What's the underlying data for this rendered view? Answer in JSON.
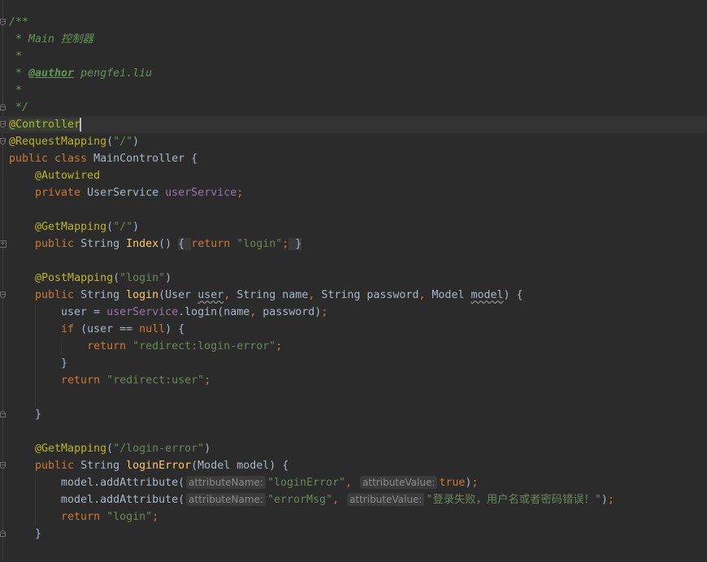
{
  "theme_colors": {
    "background": "#2B2B2B",
    "caret_row": "#323232",
    "keyword": "#CC7832",
    "string": "#6A8759",
    "annotation": "#BBB529",
    "doc_comment": "#629755",
    "field": "#9876AA",
    "method": "#FFC66D",
    "default": "#A9B7C6"
  },
  "caret_line": 6,
  "lines": [
    [
      {
        "t": "/**",
        "c": "doc"
      }
    ],
    [
      {
        "t": " * Main 控制器",
        "c": "doc"
      }
    ],
    [
      {
        "t": " *",
        "c": "doc"
      }
    ],
    [
      {
        "t": " * ",
        "c": "doc"
      },
      {
        "t": "@author",
        "c": "tag"
      },
      {
        "t": " pengfei.liu",
        "c": "doc"
      }
    ],
    [
      {
        "t": " *",
        "c": "doc"
      }
    ],
    [
      {
        "t": " */",
        "c": "doc"
      }
    ],
    [
      {
        "t": "@Controller",
        "c": "ann hl"
      }
    ],
    [
      {
        "t": "@RequestMapping",
        "c": "ann"
      },
      {
        "t": "(",
        "c": "def"
      },
      {
        "t": "\"/\"",
        "c": "str"
      },
      {
        "t": ")",
        "c": "def"
      }
    ],
    [
      {
        "t": "public class ",
        "c": "kw"
      },
      {
        "t": "MainController {",
        "c": "def"
      }
    ],
    [
      {
        "t": "    ",
        "c": "def"
      },
      {
        "t": "@Autowired",
        "c": "ann"
      }
    ],
    [
      {
        "t": "    private ",
        "c": "kw"
      },
      {
        "t": "UserService ",
        "c": "def"
      },
      {
        "t": "userService",
        "c": "fld"
      },
      {
        "t": ";",
        "c": "kw"
      }
    ],
    [],
    [
      {
        "t": "    ",
        "c": "def"
      },
      {
        "t": "@GetMapping",
        "c": "ann"
      },
      {
        "t": "(",
        "c": "def"
      },
      {
        "t": "\"/\"",
        "c": "str"
      },
      {
        "t": ")",
        "c": "def"
      }
    ],
    [
      {
        "t": "    public ",
        "c": "kw"
      },
      {
        "t": "String ",
        "c": "def"
      },
      {
        "t": "Index",
        "c": "mth"
      },
      {
        "t": "() ",
        "c": "def"
      },
      {
        "t": "{ ",
        "c": "folded"
      },
      {
        "t": "return ",
        "c": "kw"
      },
      {
        "t": "\"login\"",
        "c": "str"
      },
      {
        "t": ";",
        "c": "kw"
      },
      {
        "t": " }",
        "c": "folded"
      }
    ],
    [],
    [
      {
        "t": "    ",
        "c": "def"
      },
      {
        "t": "@PostMapping",
        "c": "ann"
      },
      {
        "t": "(",
        "c": "def"
      },
      {
        "t": "\"login\"",
        "c": "str"
      },
      {
        "t": ")",
        "c": "def"
      }
    ],
    [
      {
        "t": "    public ",
        "c": "kw"
      },
      {
        "t": "String ",
        "c": "def"
      },
      {
        "t": "login",
        "c": "mth"
      },
      {
        "t": "(User ",
        "c": "def"
      },
      {
        "t": "user",
        "c": "warn"
      },
      {
        "t": ", ",
        "c": "kw"
      },
      {
        "t": "String name",
        "c": "def"
      },
      {
        "t": ", ",
        "c": "kw"
      },
      {
        "t": "String password",
        "c": "def"
      },
      {
        "t": ", ",
        "c": "kw"
      },
      {
        "t": "Model ",
        "c": "def"
      },
      {
        "t": "model",
        "c": "warn"
      },
      {
        "t": ") {",
        "c": "def"
      }
    ],
    [
      {
        "t": "        user = ",
        "c": "def"
      },
      {
        "t": "userService",
        "c": "fld"
      },
      {
        "t": ".login(name",
        "c": "def"
      },
      {
        "t": ", ",
        "c": "kw"
      },
      {
        "t": "password)",
        "c": "def"
      },
      {
        "t": ";",
        "c": "kw"
      }
    ],
    [
      {
        "t": "        if ",
        "c": "kw"
      },
      {
        "t": "(user == ",
        "c": "def"
      },
      {
        "t": "null",
        "c": "kw"
      },
      {
        "t": ") {",
        "c": "def"
      }
    ],
    [
      {
        "t": "            return ",
        "c": "kw"
      },
      {
        "t": "\"redirect:login-error\"",
        "c": "str"
      },
      {
        "t": ";",
        "c": "kw"
      }
    ],
    [
      {
        "t": "        }",
        "c": "def"
      }
    ],
    [
      {
        "t": "        return ",
        "c": "kw"
      },
      {
        "t": "\"redirect:user\"",
        "c": "str"
      },
      {
        "t": ";",
        "c": "kw"
      }
    ],
    [],
    [
      {
        "t": "    }",
        "c": "def"
      }
    ],
    [],
    [
      {
        "t": "    ",
        "c": "def"
      },
      {
        "t": "@GetMapping",
        "c": "ann"
      },
      {
        "t": "(",
        "c": "def"
      },
      {
        "t": "\"/login-error\"",
        "c": "str"
      },
      {
        "t": ")",
        "c": "def"
      }
    ],
    [
      {
        "t": "    public ",
        "c": "kw"
      },
      {
        "t": "String ",
        "c": "def"
      },
      {
        "t": "loginError",
        "c": "mth"
      },
      {
        "t": "(Model model) {",
        "c": "def"
      }
    ],
    [
      {
        "t": "        model.addAttribute(",
        "c": "def"
      },
      {
        "t": "attributeName:",
        "c": "hint"
      },
      {
        "t": "\"loginError\"",
        "c": "str"
      },
      {
        "t": ", ",
        "c": "kw"
      },
      {
        "t": "attributeValue:",
        "c": "hint"
      },
      {
        "t": "true",
        "c": "kw"
      },
      {
        "t": ")",
        "c": "def"
      },
      {
        "t": ";",
        "c": "kw"
      }
    ],
    [
      {
        "t": "        model.addAttribute(",
        "c": "def"
      },
      {
        "t": "attributeName:",
        "c": "hint"
      },
      {
        "t": "\"errorMsg\"",
        "c": "str"
      },
      {
        "t": ", ",
        "c": "kw"
      },
      {
        "t": "attributeValue:",
        "c": "hint"
      },
      {
        "t": "\"登录失败，用户名或者密码错误！\"",
        "c": "str"
      },
      {
        "t": ")",
        "c": "def"
      },
      {
        "t": ";",
        "c": "kw"
      }
    ],
    [
      {
        "t": "        return ",
        "c": "kw"
      },
      {
        "t": "\"login\"",
        "c": "str"
      },
      {
        "t": ";",
        "c": "kw"
      }
    ],
    [
      {
        "t": "    }",
        "c": "def"
      }
    ]
  ],
  "fold_markers": [
    {
      "line": 0,
      "kind": "start"
    },
    {
      "line": 5,
      "kind": "end"
    },
    {
      "line": 6,
      "kind": "start"
    },
    {
      "line": 7,
      "kind": "start"
    },
    {
      "line": 13,
      "kind": "collapsed"
    },
    {
      "line": 16,
      "kind": "start"
    },
    {
      "line": 23,
      "kind": "end"
    },
    {
      "line": 26,
      "kind": "start"
    },
    {
      "line": 30,
      "kind": "end"
    }
  ]
}
